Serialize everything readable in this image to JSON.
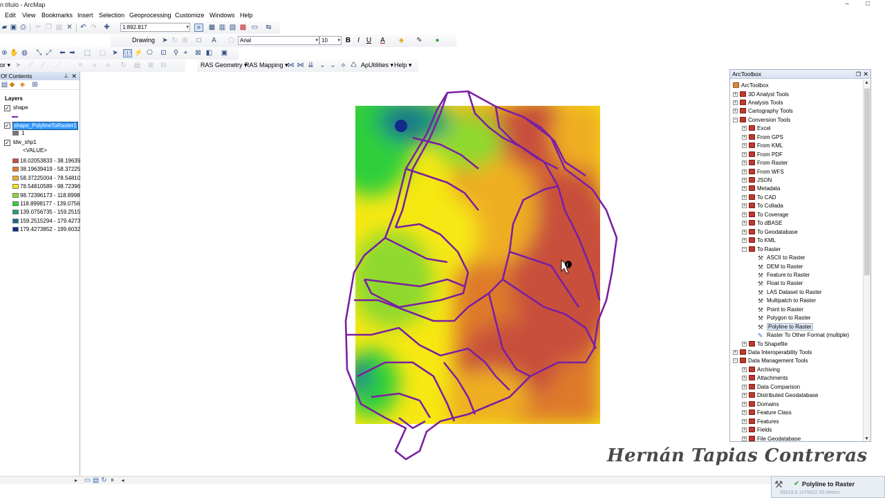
{
  "window": {
    "title": "n título - ArcMap",
    "minimize": "–",
    "maximize": "□"
  },
  "menu": [
    "Edit",
    "View",
    "Bookmarks",
    "Insert",
    "Selection",
    "Geoprocessing",
    "Customize",
    "Windows",
    "Help"
  ],
  "toolbar_standard": {
    "scale": "1:892.817"
  },
  "toolbar_draw": {
    "drawing_label": "Drawing",
    "font_name": "Arial",
    "font_size": "10",
    "bold": "B",
    "italic": "I",
    "underline": "U",
    "text_a": "A"
  },
  "toolbar_ras": {
    "geometry": "RAS Geometry",
    "mapping": "RAS Mapping",
    "aputilities": "ApUtilities",
    "help": "Help"
  },
  "toc": {
    "header": "Of Contents",
    "pin": "⊥",
    "close": "✕",
    "layers_label": "Layers",
    "layer1": "shape",
    "layer2": "shape_PolylineToRaster1",
    "layer2_value": "1",
    "layer3": "ldw_shp1",
    "value_label": "<VALUE>",
    "classes": [
      {
        "label": "18.02053833 - 38.19639",
        "color": "#c8503a"
      },
      {
        "label": "38.19639419 - 58.37225",
        "color": "#de7a2a"
      },
      {
        "label": "58.37225004 - 78.54810",
        "color": "#efae24"
      },
      {
        "label": "78.54810589 - 98.72396",
        "color": "#f6e812"
      },
      {
        "label": "98.72396173 - 118.8998",
        "color": "#8fd92e"
      },
      {
        "label": "118.8998177 - 139.0756",
        "color": "#2fcf3a"
      },
      {
        "label": "139.0756735 - 159.2515",
        "color": "#1f9e74"
      },
      {
        "label": "159.2515294 - 179.4273",
        "color": "#1d6a8f"
      },
      {
        "label": "179.4273852 - 199.6032",
        "color": "#122a8a"
      }
    ]
  },
  "toolbox": {
    "title": "ArcToolbox",
    "root": "ArcToolbox",
    "items": [
      {
        "label": "3D Analyst Tools",
        "level": 1,
        "kind": "box",
        "exp": "+"
      },
      {
        "label": "Analysis Tools",
        "level": 1,
        "kind": "box",
        "exp": "+"
      },
      {
        "label": "Cartography Tools",
        "level": 1,
        "kind": "box",
        "exp": "+"
      },
      {
        "label": "Conversion Tools",
        "level": 1,
        "kind": "box",
        "exp": "−"
      },
      {
        "label": "Excel",
        "level": 2,
        "kind": "box",
        "exp": "+"
      },
      {
        "label": "From GPS",
        "level": 2,
        "kind": "box",
        "exp": "+"
      },
      {
        "label": "From KML",
        "level": 2,
        "kind": "box",
        "exp": "+"
      },
      {
        "label": "From PDF",
        "level": 2,
        "kind": "box",
        "exp": "+"
      },
      {
        "label": "From Raster",
        "level": 2,
        "kind": "box",
        "exp": "+"
      },
      {
        "label": "From WFS",
        "level": 2,
        "kind": "box",
        "exp": "+"
      },
      {
        "label": "JSON",
        "level": 2,
        "kind": "box",
        "exp": "+"
      },
      {
        "label": "Metadata",
        "level": 2,
        "kind": "box",
        "exp": "+"
      },
      {
        "label": "To CAD",
        "level": 2,
        "kind": "box",
        "exp": "+"
      },
      {
        "label": "To Collada",
        "level": 2,
        "kind": "box",
        "exp": "+"
      },
      {
        "label": "To Coverage",
        "level": 2,
        "kind": "box",
        "exp": "+"
      },
      {
        "label": "To dBASE",
        "level": 2,
        "kind": "box",
        "exp": "+"
      },
      {
        "label": "To Geodatabase",
        "level": 2,
        "kind": "box",
        "exp": "+"
      },
      {
        "label": "To KML",
        "level": 2,
        "kind": "box",
        "exp": "+"
      },
      {
        "label": "To Raster",
        "level": 2,
        "kind": "box",
        "exp": "−"
      },
      {
        "label": "ASCII to Raster",
        "level": 3,
        "kind": "tool",
        "exp": ""
      },
      {
        "label": "DEM to Raster",
        "level": 3,
        "kind": "tool",
        "exp": ""
      },
      {
        "label": "Feature to Raster",
        "level": 3,
        "kind": "tool",
        "exp": ""
      },
      {
        "label": "Float to Raster",
        "level": 3,
        "kind": "tool",
        "exp": ""
      },
      {
        "label": "LAS Dataset to Raster",
        "level": 3,
        "kind": "tool",
        "exp": ""
      },
      {
        "label": "Multipatch to Raster",
        "level": 3,
        "kind": "tool",
        "exp": ""
      },
      {
        "label": "Point to Raster",
        "level": 3,
        "kind": "tool",
        "exp": ""
      },
      {
        "label": "Polygon to Raster",
        "level": 3,
        "kind": "tool",
        "exp": ""
      },
      {
        "label": "Polyline to Raster",
        "level": 3,
        "kind": "tool",
        "exp": "",
        "selected": true
      },
      {
        "label": "Raster To Other Format (multiple)",
        "level": 3,
        "kind": "script",
        "exp": ""
      },
      {
        "label": "To Shapefile",
        "level": 2,
        "kind": "box",
        "exp": "+"
      },
      {
        "label": "Data Interoperability Tools",
        "level": 1,
        "kind": "box",
        "exp": "+"
      },
      {
        "label": "Data Management Tools",
        "level": 1,
        "kind": "box",
        "exp": "−"
      },
      {
        "label": "Archiving",
        "level": 2,
        "kind": "box",
        "exp": "+"
      },
      {
        "label": "Attachments",
        "level": 2,
        "kind": "box",
        "exp": "+"
      },
      {
        "label": "Data Comparison",
        "level": 2,
        "kind": "box",
        "exp": "+"
      },
      {
        "label": "Distributed Geodatabase",
        "level": 2,
        "kind": "box",
        "exp": "+"
      },
      {
        "label": "Domains",
        "level": 2,
        "kind": "box",
        "exp": "+"
      },
      {
        "label": "Feature Class",
        "level": 2,
        "kind": "box",
        "exp": "+"
      },
      {
        "label": "Features",
        "level": 2,
        "kind": "box",
        "exp": "+"
      },
      {
        "label": "Fields",
        "level": 2,
        "kind": "box",
        "exp": "+"
      },
      {
        "label": "File Geodatabase",
        "level": 2,
        "kind": "box",
        "exp": "+"
      }
    ]
  },
  "watermark": "Hernán Tapias Contreras",
  "notification": {
    "title": "Polyline to Raster",
    "status": "69519.9  1479522.55 Meters"
  },
  "colors": {
    "polyline": "#7a1fa2",
    "selection": "#3399ff"
  }
}
